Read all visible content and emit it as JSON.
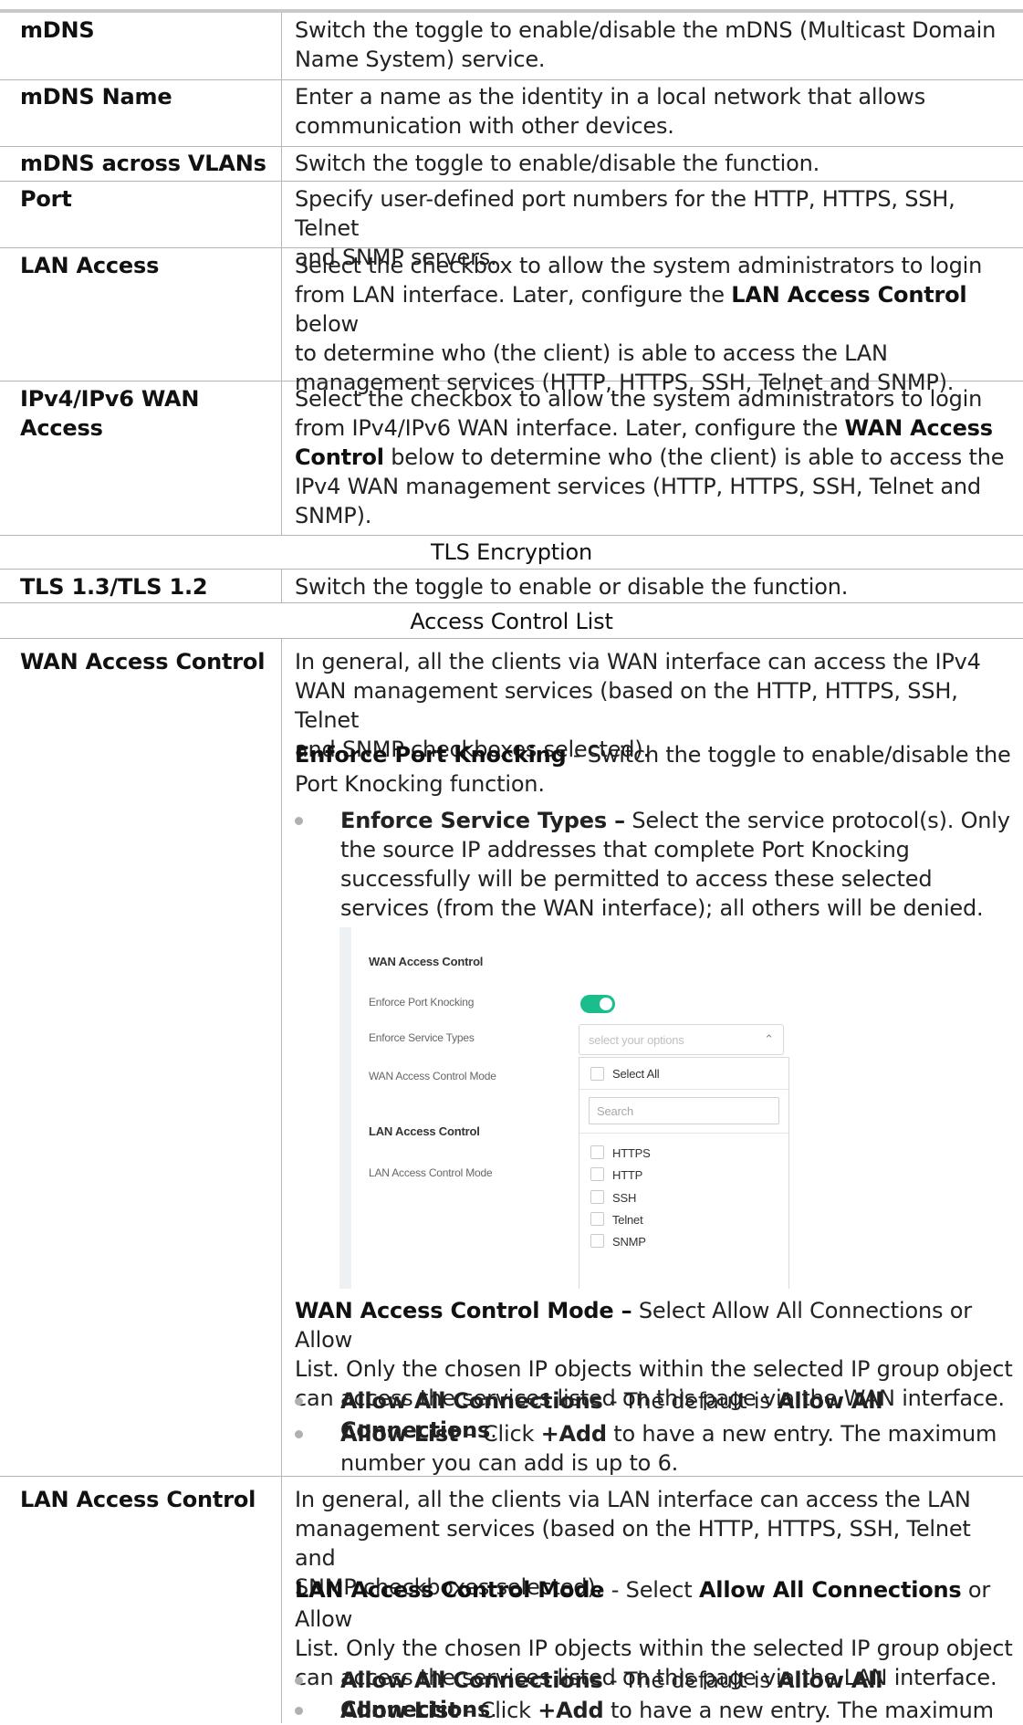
{
  "rows": {
    "mdns": {
      "label": "mDNS",
      "line1": "Switch the toggle to enable/disable the mDNS (Multicast Domain",
      "line2": "Name System) service."
    },
    "mdns_name": {
      "label": "mDNS Name",
      "line1": "Enter a name as the identity in a local network that allows",
      "line2": "communication with other devices."
    },
    "mdns_vlans": {
      "label": "mDNS across VLANs",
      "line1": "Switch the toggle to enable/disable the function."
    },
    "port": {
      "label": "Port",
      "line1": "Specify user-defined port numbers for the HTTP, HTTPS, SSH, Telnet",
      "line2": "and SNMP servers."
    },
    "lan_access": {
      "label": "LAN Access",
      "line1": "Select the checkbox to allow the system administrators to login",
      "line2a": "from LAN interface. Later, configure the ",
      "line2b": "LAN Access Control",
      "line2c": " below",
      "line3": "to determine who (the client) is able to access the LAN",
      "line4": "management services (HTTP, HTTPS, SSH, Telnet and SNMP)."
    },
    "wan_access": {
      "label": "IPv4/IPv6 WAN Access",
      "line1": "Select the checkbox to allow the system administrators to login",
      "line2a": "from IPv4/IPv6 WAN interface. Later, configure the ",
      "line2b": "WAN Access",
      "line3a": "Control",
      "line3b": " below to determine who (the client) is able to access the",
      "line4": "IPv4 WAN management services (HTTP, HTTPS, SSH, Telnet and",
      "line5": "SNMP)."
    },
    "tls": {
      "label": "TLS 1.3/TLS 1.2",
      "line1": "Switch the toggle to enable or disable the function."
    },
    "wan_control": {
      "label": "WAN Access Control",
      "p1_line1": "In general, all the clients via WAN interface can access the IPv4",
      "p1_line2": "WAN management services (based on the HTTP, HTTPS, SSH, Telnet",
      "p1_line3": "and SNMP checkboxes selected).",
      "p2_bold": "Enforce Port Knocking",
      "p2_rest": " - Switch the toggle to enable/disable the",
      "p2_line2": "Port Knocking function.",
      "b1_bold": "Enforce Service Types –",
      "b1_rest": " Select the service protocol(s). Only",
      "b1_line2": "the source IP addresses that complete Port Knocking",
      "b1_line3": "successfully will be permitted to access these selected",
      "b1_line4": "services (from the WAN interface); all others will be denied.",
      "p3_bold": "WAN Access Control Mode –",
      "p3_rest": " Select Allow All Connections or Allow",
      "p3_line2": "List. Only the chosen IP objects within the selected IP group object",
      "p3_line3": "can access the services listed on this page via the WAN interface.",
      "b2_bold": "Allow All Connections",
      "b2_mid": " - The default is ",
      "b2_bold2": "Allow All Connections",
      "b2_end": ".",
      "b3_bold": "Allow List",
      "b3_mid": " – Click ",
      "b3_bold2": "+Add",
      "b3_end": " to have a new entry. The maximum",
      "b3_line2": "number you can add is up to 6."
    },
    "lan_control": {
      "label": "LAN Access Control",
      "p1_line1": "In general, all the clients via LAN interface can access the LAN",
      "p1_line2": "management services (based on the HTTP, HTTPS, SSH, Telnet and",
      "p1_line3": "SNMP checkboxes selected).",
      "p2_bold": "LAN Access Control Mode",
      "p2_mid": " - Select ",
      "p2_bold2": "Allow All Connections",
      "p2_end": " or Allow",
      "p2_line2": "List. Only the chosen IP objects within the selected IP group object",
      "p2_line3": "can access the services listed on this page via the LAN interface.",
      "b1_bold": "Allow All Connections",
      "b1_mid": " - The default is ",
      "b1_bold2": "Allow All Connections",
      "b1_end": ".",
      "b2_bold": "Allow List",
      "b2_mid": " - Click ",
      "b2_bold2": "+Add",
      "b2_end": " to have a new entry. The maximum"
    }
  },
  "sections": {
    "tls": "TLS Encryption",
    "acl": "Access Control List"
  },
  "screenshot": {
    "title": "WAN Access Control",
    "enforce_port_knocking": "Enforce Port Knocking",
    "enforce_port_knocking_on": true,
    "enforce_service_types": "Enforce Service Types",
    "select_placeholder": "select your options",
    "wan_mode": "WAN Access Control Mode",
    "lan_title": "LAN Access Control",
    "lan_mode": "LAN Access Control Mode",
    "select_all": "Select All",
    "search_placeholder": "Search",
    "options": [
      "HTTPS",
      "HTTP",
      "SSH",
      "Telnet",
      "SNMP"
    ],
    "toggle_color": "#1bbd8c"
  }
}
